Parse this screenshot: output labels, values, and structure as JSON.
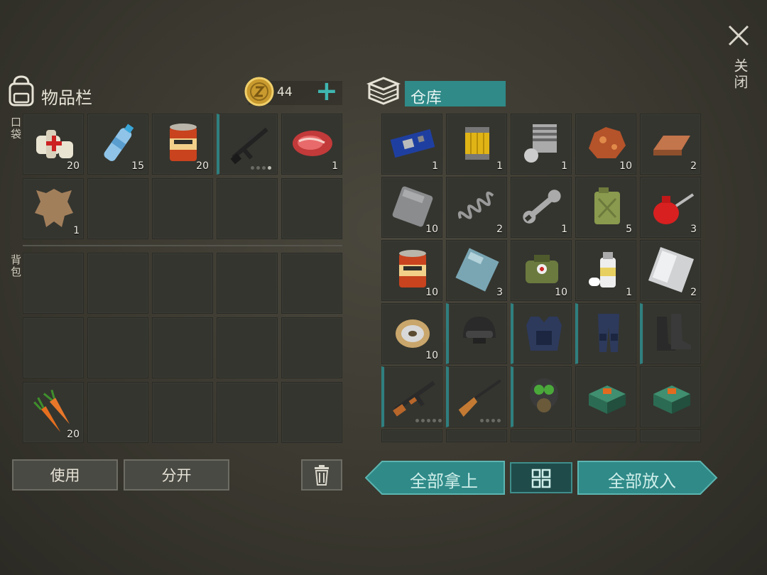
{
  "close_label": "关闭",
  "inventory": {
    "title": "物品栏",
    "coin_value": "44",
    "plus": "+",
    "pocket_label": "口袋",
    "backpack_label": "背包"
  },
  "storage": {
    "title": "仓库"
  },
  "pocket_items": [
    {
      "name": "bandage",
      "count": "20"
    },
    {
      "name": "water-bottle",
      "count": "15"
    },
    {
      "name": "canned-food",
      "count": "20"
    },
    {
      "name": "m16-rifle",
      "count": ""
    },
    {
      "name": "raw-meat",
      "count": "1"
    },
    {
      "name": "animal-hide",
      "count": "1"
    }
  ],
  "backpack_items": [
    {
      "name": "carrots",
      "count": "20"
    }
  ],
  "storage_items": [
    {
      "name": "circuit-board",
      "count": "1"
    },
    {
      "name": "oil-filter",
      "count": "1"
    },
    {
      "name": "engine-cylinder",
      "count": "1"
    },
    {
      "name": "ore",
      "count": "10"
    },
    {
      "name": "copper-ingot",
      "count": "2"
    },
    {
      "name": "metal-plate",
      "count": "10"
    },
    {
      "name": "spring",
      "count": "2"
    },
    {
      "name": "wrench",
      "count": "1"
    },
    {
      "name": "jerry-can",
      "count": "5"
    },
    {
      "name": "oil-can",
      "count": "3"
    },
    {
      "name": "canned-food",
      "count": "10"
    },
    {
      "name": "glass-plate",
      "count": "3"
    },
    {
      "name": "medkit-bag",
      "count": "10"
    },
    {
      "name": "spray-can",
      "count": "1"
    },
    {
      "name": "steel-sheet",
      "count": "2"
    },
    {
      "name": "wire-spool",
      "count": "10"
    },
    {
      "name": "swat-helmet",
      "count": ""
    },
    {
      "name": "swat-vest",
      "count": ""
    },
    {
      "name": "swat-pants",
      "count": ""
    },
    {
      "name": "swat-boots",
      "count": ""
    },
    {
      "name": "ak-rifle",
      "count": ""
    },
    {
      "name": "hunting-rifle",
      "count": ""
    },
    {
      "name": "gas-mask",
      "count": ""
    },
    {
      "name": "explosive-crate",
      "count": ""
    },
    {
      "name": "explosive-crate",
      "count": ""
    }
  ],
  "buttons": {
    "use": "使用",
    "split": "分开",
    "take_all": "全部拿上",
    "put_all": "全部放入"
  }
}
